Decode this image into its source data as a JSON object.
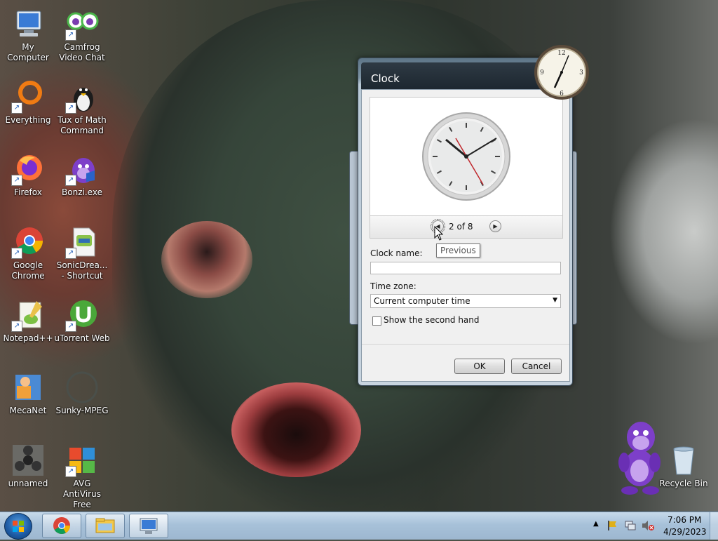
{
  "desktop": {
    "left_icons": [
      {
        "label_1": "My Computer",
        "label_2": "",
        "icon": "computer-icon",
        "shortcut": false
      },
      {
        "label_1": "Everything",
        "label_2": "",
        "icon": "everything-icon",
        "shortcut": true
      },
      {
        "label_1": "Firefox",
        "label_2": "",
        "icon": "firefox-icon",
        "shortcut": true
      },
      {
        "label_1": "Google",
        "label_2": "Chrome",
        "icon": "chrome-icon",
        "shortcut": true
      },
      {
        "label_1": "Notepad++",
        "label_2": "",
        "icon": "notepadpp-icon",
        "shortcut": true
      },
      {
        "label_1": "MecaNet",
        "label_2": "",
        "icon": "mecanet-icon",
        "shortcut": false
      },
      {
        "label_1": "unnamed",
        "label_2": "",
        "icon": "fidget-spinner-icon",
        "shortcut": false
      }
    ],
    "right_icons": [
      {
        "label_1": "Camfrog",
        "label_2": "Video Chat",
        "icon": "camfrog-icon",
        "shortcut": true
      },
      {
        "label_1": "Tux of Math",
        "label_2": "Command",
        "icon": "tux-icon",
        "shortcut": true
      },
      {
        "label_1": "Bonzi.exe",
        "label_2": "",
        "icon": "bonzi-icon",
        "shortcut": true
      },
      {
        "label_1": "SonicDrea...",
        "label_2": "- Shortcut",
        "icon": "sonic-file-icon",
        "shortcut": true
      },
      {
        "label_1": "uTorrent Web",
        "label_2": "",
        "icon": "utorrent-icon",
        "shortcut": true
      },
      {
        "label_1": "Sunky-MPEG",
        "label_2": "",
        "icon": "sunky-mpeg-icon",
        "shortcut": false
      },
      {
        "label_1": "AVG AntiVirus",
        "label_2": "Free",
        "icon": "avg-icon",
        "shortcut": true
      }
    ],
    "recycle_bin": "Recycle Bin"
  },
  "clock_dialog": {
    "title": "Clock",
    "page_indicator": "2 of 8",
    "tooltip": "Previous",
    "clock_name_label": "Clock name:",
    "clock_name_value": "",
    "time_zone_label": "Time zone:",
    "time_zone_value": "Current computer time",
    "second_hand_label": "Show the second hand",
    "second_hand_checked": false,
    "ok_label": "OK",
    "cancel_label": "Cancel"
  },
  "taskbar": {
    "time": "7:06 PM",
    "date": "4/29/2023",
    "pinned": [
      "chrome-icon",
      "explorer-icon",
      "remote-desktop-icon"
    ]
  },
  "colors": {
    "taskbar": "#a7c1d9",
    "dialog_title": "#1d2730",
    "chrome_red": "#db4437",
    "chrome_green": "#0f9d58",
    "chrome_yellow": "#f4b400",
    "chrome_blue": "#4285f4"
  }
}
